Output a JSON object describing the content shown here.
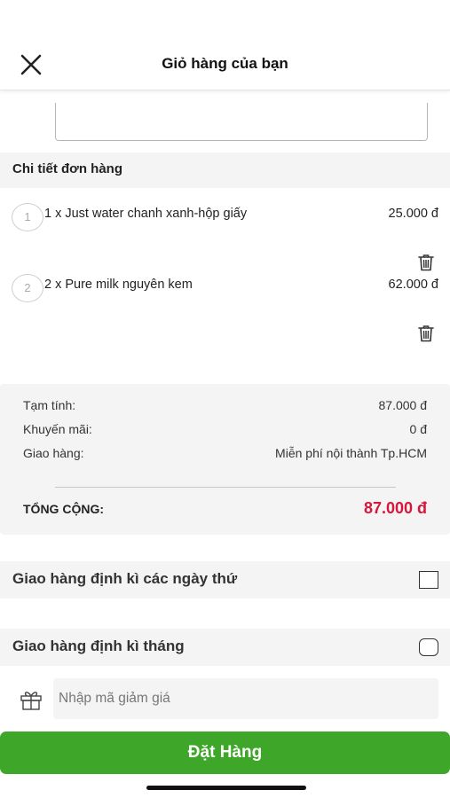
{
  "header": {
    "title": "Giỏ hàng của bạn",
    "close_icon": "close-icon"
  },
  "order_section": {
    "title": "Chi tiết đơn hàng"
  },
  "items": [
    {
      "index": "1",
      "name": "1 x Just water chanh xanh-hộp giấy",
      "price": "25.000 đ",
      "delete_icon": "trash-icon"
    },
    {
      "index": "2",
      "name": "2 x Pure milk nguyên kem",
      "price": "62.000 đ",
      "delete_icon": "trash-icon"
    }
  ],
  "summary": {
    "subtotal_label": "Tạm tính:",
    "subtotal_value": "87.000 đ",
    "promo_label": "Khuyến mãi:",
    "promo_value": "0 đ",
    "shipping_label": "Giao hàng:",
    "shipping_value": "Miễn phí nội thành Tp.HCM",
    "total_label": "TỔNG CỘNG:",
    "total_value": "87.000 đ"
  },
  "options": {
    "weekly_label": "Giao hàng định kì các ngày thứ",
    "monthly_label": "Giao hàng định kì tháng"
  },
  "coupon": {
    "placeholder": "Nhập mã giảm giá",
    "icon": "gift-icon"
  },
  "order_button": {
    "label": "Đặt Hàng"
  },
  "colors": {
    "accent": "#3ea628",
    "total": "#d6163c",
    "panel": "#f4f4f4"
  }
}
